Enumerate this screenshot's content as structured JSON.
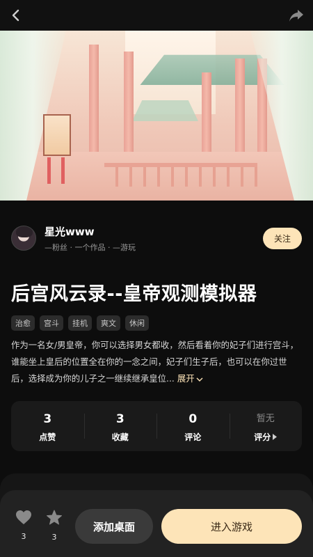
{
  "nav": {
    "back_icon": "chevron-left-icon",
    "share_icon": "share-icon"
  },
  "author": {
    "name": "星光www",
    "meta": "—粉丝 · 一个作品 · —游玩",
    "follow_label": "关注"
  },
  "game": {
    "title": "后宫风云录--皇帝观测模拟器",
    "tags": [
      "治愈",
      "宫斗",
      "挂机",
      "爽文",
      "休闲"
    ],
    "description": "作为一名女/男皇帝，你可以选择男女都收，然后看着你的妃子们进行宫斗，谁能坐上皇后的位置全在你的一念之间，妃子们生子后，也可以在你过世后，选择成为你的儿子之一继续继承皇位...",
    "expand_label": "展开"
  },
  "stats": [
    {
      "value": "3",
      "label": "点赞"
    },
    {
      "value": "3",
      "label": "收藏"
    },
    {
      "value": "0",
      "label": "评论"
    },
    {
      "value": "暂无",
      "label": "评分"
    }
  ],
  "bottom": {
    "like_count": "3",
    "favorite_count": "3",
    "add_desktop_label": "添加桌面",
    "enter_game_label": "进入游戏"
  },
  "colors": {
    "accent": "#fde4b8",
    "background": "#0d0d0d"
  }
}
